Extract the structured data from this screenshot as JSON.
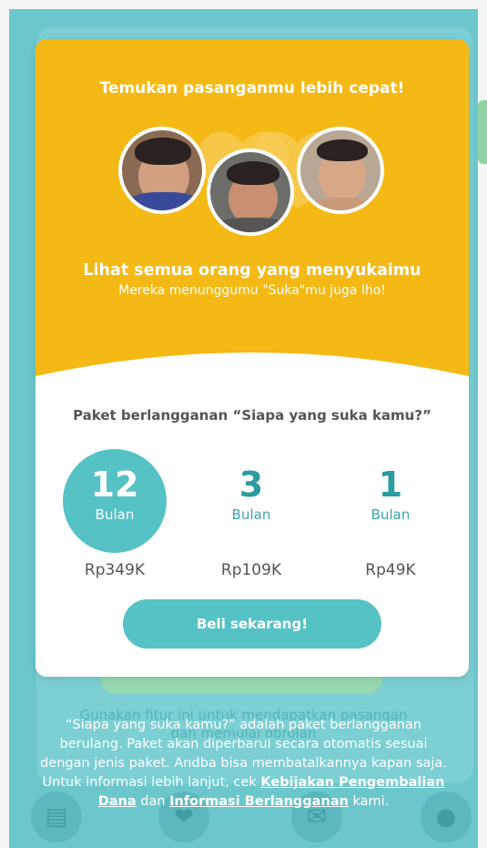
{
  "background": {
    "hint_text_1": "Gunakan fitur ini untuk mendapatkan pasangan",
    "hint_text_2": "dan memulai obrolan"
  },
  "modal": {
    "title": "Temukan pasanganmu lebih cepat!",
    "headline": "Lihat semua orang yang menyukaimu",
    "subline": "Mereka menunggumu \"Suka\"mu juga lho!",
    "package_title": "Paket berlangganan “Siapa yang suka kamu?”",
    "plans": [
      {
        "count": "12",
        "unit": "Bulan",
        "price": "Rp349K",
        "selected": true
      },
      {
        "count": "3",
        "unit": "Bulan",
        "price": "Rp109K",
        "selected": false
      },
      {
        "count": "1",
        "unit": "Bulan",
        "price": "Rp49K",
        "selected": false
      }
    ],
    "buy_button": "Beli sekarang!"
  },
  "footer": {
    "text_1": "“Siapa yang suka kamu?” adalah paket berlangganan berulang. Paket akan diperbarui secara otomatis sesuai dengan jenis paket. Andba bisa membatalkannya kapan saja. Untuk informasi lebih lanjut, cek ",
    "link_refund": "Kebijakan Pengembalian Dana",
    "text_2": " dan ",
    "link_subscription": "Informasi Berlangganan",
    "text_3": " kami."
  },
  "colors": {
    "accent": "#55c2c6",
    "header_yellow": "#f5b915",
    "overlay": "#6cc7cc"
  },
  "icons": [
    "profile-icon",
    "like-icon",
    "chat-icon",
    "user-icon"
  ]
}
